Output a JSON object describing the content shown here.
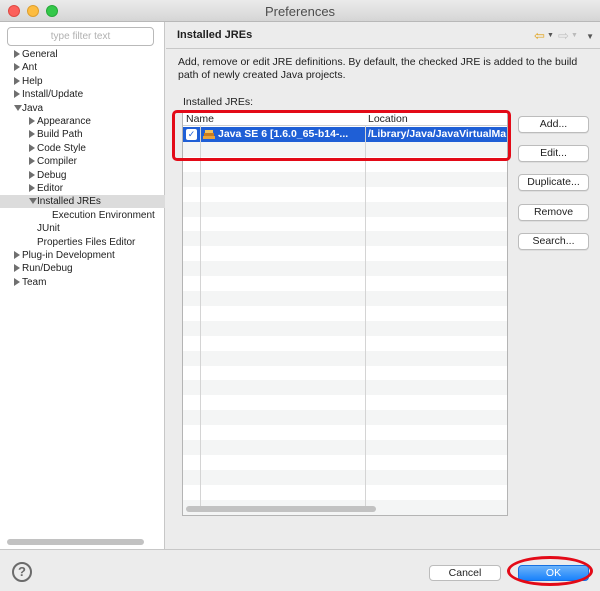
{
  "window": {
    "title": "Preferences"
  },
  "sidebar": {
    "filter_placeholder": "type filter text",
    "items": [
      {
        "label": "General",
        "level": 0,
        "expanded": false
      },
      {
        "label": "Ant",
        "level": 0,
        "expanded": false
      },
      {
        "label": "Help",
        "level": 0,
        "expanded": false
      },
      {
        "label": "Install/Update",
        "level": 0,
        "expanded": false
      },
      {
        "label": "Java",
        "level": 0,
        "expanded": true
      },
      {
        "label": "Appearance",
        "level": 1,
        "expanded": false
      },
      {
        "label": "Build Path",
        "level": 1,
        "expanded": false
      },
      {
        "label": "Code Style",
        "level": 1,
        "expanded": false
      },
      {
        "label": "Compiler",
        "level": 1,
        "expanded": false
      },
      {
        "label": "Debug",
        "level": 1,
        "expanded": false
      },
      {
        "label": "Editor",
        "level": 1,
        "expanded": false
      },
      {
        "label": "Installed JREs",
        "level": 1,
        "expanded": true,
        "selected": true
      },
      {
        "label": "Execution Environment",
        "level": 2
      },
      {
        "label": "JUnit",
        "level": 1
      },
      {
        "label": "Properties Files Editor",
        "level": 1
      },
      {
        "label": "Plug-in Development",
        "level": 0,
        "expanded": false
      },
      {
        "label": "Run/Debug",
        "level": 0,
        "expanded": false
      },
      {
        "label": "Team",
        "level": 0,
        "expanded": false
      }
    ]
  },
  "page": {
    "title": "Installed JREs",
    "description_line1": "Add, remove or edit JRE definitions. By default, the checked JRE is added to the build",
    "description_line2": "path of newly created Java projects.",
    "list_label": "Installed JREs:",
    "columns": [
      "Name",
      "Location"
    ],
    "rows": [
      {
        "checked": true,
        "name": "Java SE 6 [1.6.0_65-b14-...",
        "location": "/Library/Java/JavaVirtualMa"
      }
    ],
    "buttons": [
      "Add...",
      "Edit...",
      "Duplicate...",
      "Remove",
      "Search..."
    ]
  },
  "footer": {
    "help_glyph": "?",
    "cancel_label": "Cancel",
    "ok_label": "OK"
  },
  "colors": {
    "selection": "#1f5fd6",
    "ok_button": "#1a82fb",
    "annotation": "#e30a17"
  },
  "icons": {
    "help": "help-icon",
    "back": "back-arrow-icon",
    "forward": "forward-arrow-icon",
    "menu": "view-menu-icon",
    "checkbox": "checkmark-icon",
    "jre": "jre-library-icon"
  }
}
